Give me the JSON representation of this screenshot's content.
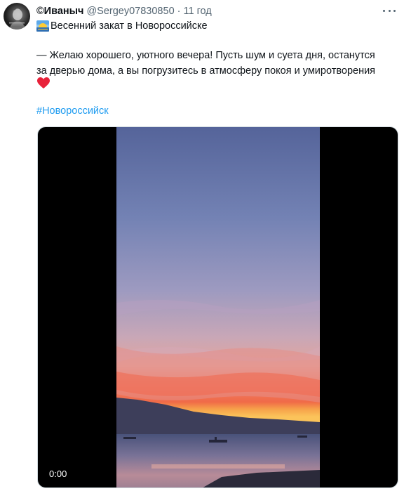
{
  "author": {
    "display_name": "©Иваныч",
    "handle": "@Sergey07830850",
    "separator": "·",
    "time_ago": "11 год"
  },
  "tweet": {
    "title_text": "Весенний закат в Новороссийске",
    "body_line_1": "— Желаю хорошего, уютного вечера! Пусть шум и суета дня, останутся",
    "body_line_2": "за дверью дома, а вы погрузитесь в атмосферу покоя и умиротворения",
    "hashtag": "#Новороссийск"
  },
  "icons": {
    "title_emoji": "sunrise-icon",
    "body_emoji": "red-heart-icon",
    "more": "more-options-icon"
  },
  "video": {
    "timestamp": "0:00"
  },
  "colors": {
    "link": "#1d9bf0",
    "secondary_text": "#536471",
    "primary_text": "#0f1419"
  }
}
